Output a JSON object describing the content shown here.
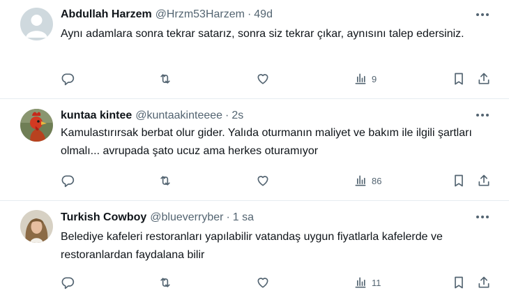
{
  "tweets": [
    {
      "name": "Abdullah Harzem",
      "handle": "@Hrzm53Harzem",
      "separator": "·",
      "time": "49d",
      "text": "Aynı adamlara sonra tekrar satarız, sonra siz tekrar çıkar, aynısını talep edersiniz.",
      "views": "9",
      "avatar": "default-avatar"
    },
    {
      "name": "kuntaa kintee",
      "handle": "@kuntaakinteeee",
      "separator": "·",
      "time": "2s",
      "text": "Kamulastırırsak berbat olur gider. Yalıda oturmanın maliyet ve bakım ile ilgili şartları olmalı... avrupada şato ucuz ama herkes oturamıyor",
      "views": "86",
      "avatar": "rooster-avatar"
    },
    {
      "name": "Turkish Cowboy",
      "handle": "@blueverryber",
      "separator": "·",
      "time": "1 sa",
      "text": "Belediye kafeleri restoranları yapılabilir vatandaş uygun fiyatlarla kafelerde ve restoranlardan faydalana bilir",
      "views": "11",
      "avatar": "woman-avatar"
    }
  ],
  "colors": {
    "text": "#0f1419",
    "muted": "#536471",
    "border": "#e6ecf0"
  }
}
